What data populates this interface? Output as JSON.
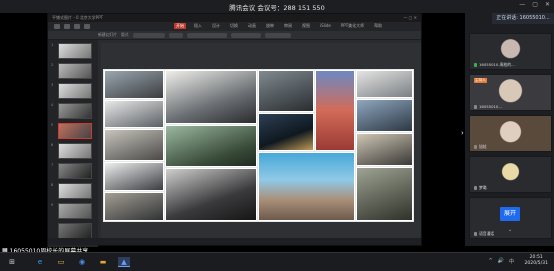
{
  "meeting": {
    "title": "腾讯会议  会议号：288 151 550",
    "window_controls": [
      "—",
      "▢",
      "✕"
    ],
    "share_badge": "正在讲话: 16055010..."
  },
  "ppt": {
    "title_left": "平铺式图片 - 0   北京大学PPT",
    "title_right": "— ▢ ✕",
    "tabs": [
      "开始",
      "插入",
      "设计",
      "切换",
      "动画",
      "放映",
      "审阅",
      "视图",
      "iSlide",
      "PPT美化大师",
      "帮助"
    ],
    "active_tab": 0,
    "ribbon_items": [
      "新建幻灯片",
      "版式",
      "重置",
      "字体",
      "段落",
      "排列",
      "样式"
    ],
    "slide_count": 9
  },
  "participants": [
    {
      "name": "16055010-周校的...",
      "mic": "on",
      "host": false
    },
    {
      "name": "16055010...",
      "mic": "off",
      "host": true,
      "host_label": "主持人"
    },
    {
      "name": "旭炫",
      "mic": "off",
      "host": false
    },
    {
      "name": "梦璐",
      "mic": "off",
      "host": false
    },
    {
      "name": "语音通话",
      "mic": "off",
      "host": false
    }
  ],
  "expand_label": "展开",
  "share_caption": "16055010周校长的屏幕共享",
  "taskbar": {
    "icons": [
      "windows-start-icon",
      "edge-icon",
      "explorer-icon",
      "teams-icon",
      "folder-icon",
      "powerpoint-icon",
      "meeting-icon"
    ],
    "time": "20:51",
    "date": "2020/5/31",
    "tray_icons": [
      "^",
      "🔊",
      "中"
    ]
  },
  "colors": {
    "accent_blue": "#1e6bf0",
    "active_tab_red": "#c2372b",
    "mic_green": "#38b34a",
    "host_orange": "#e07b39"
  }
}
